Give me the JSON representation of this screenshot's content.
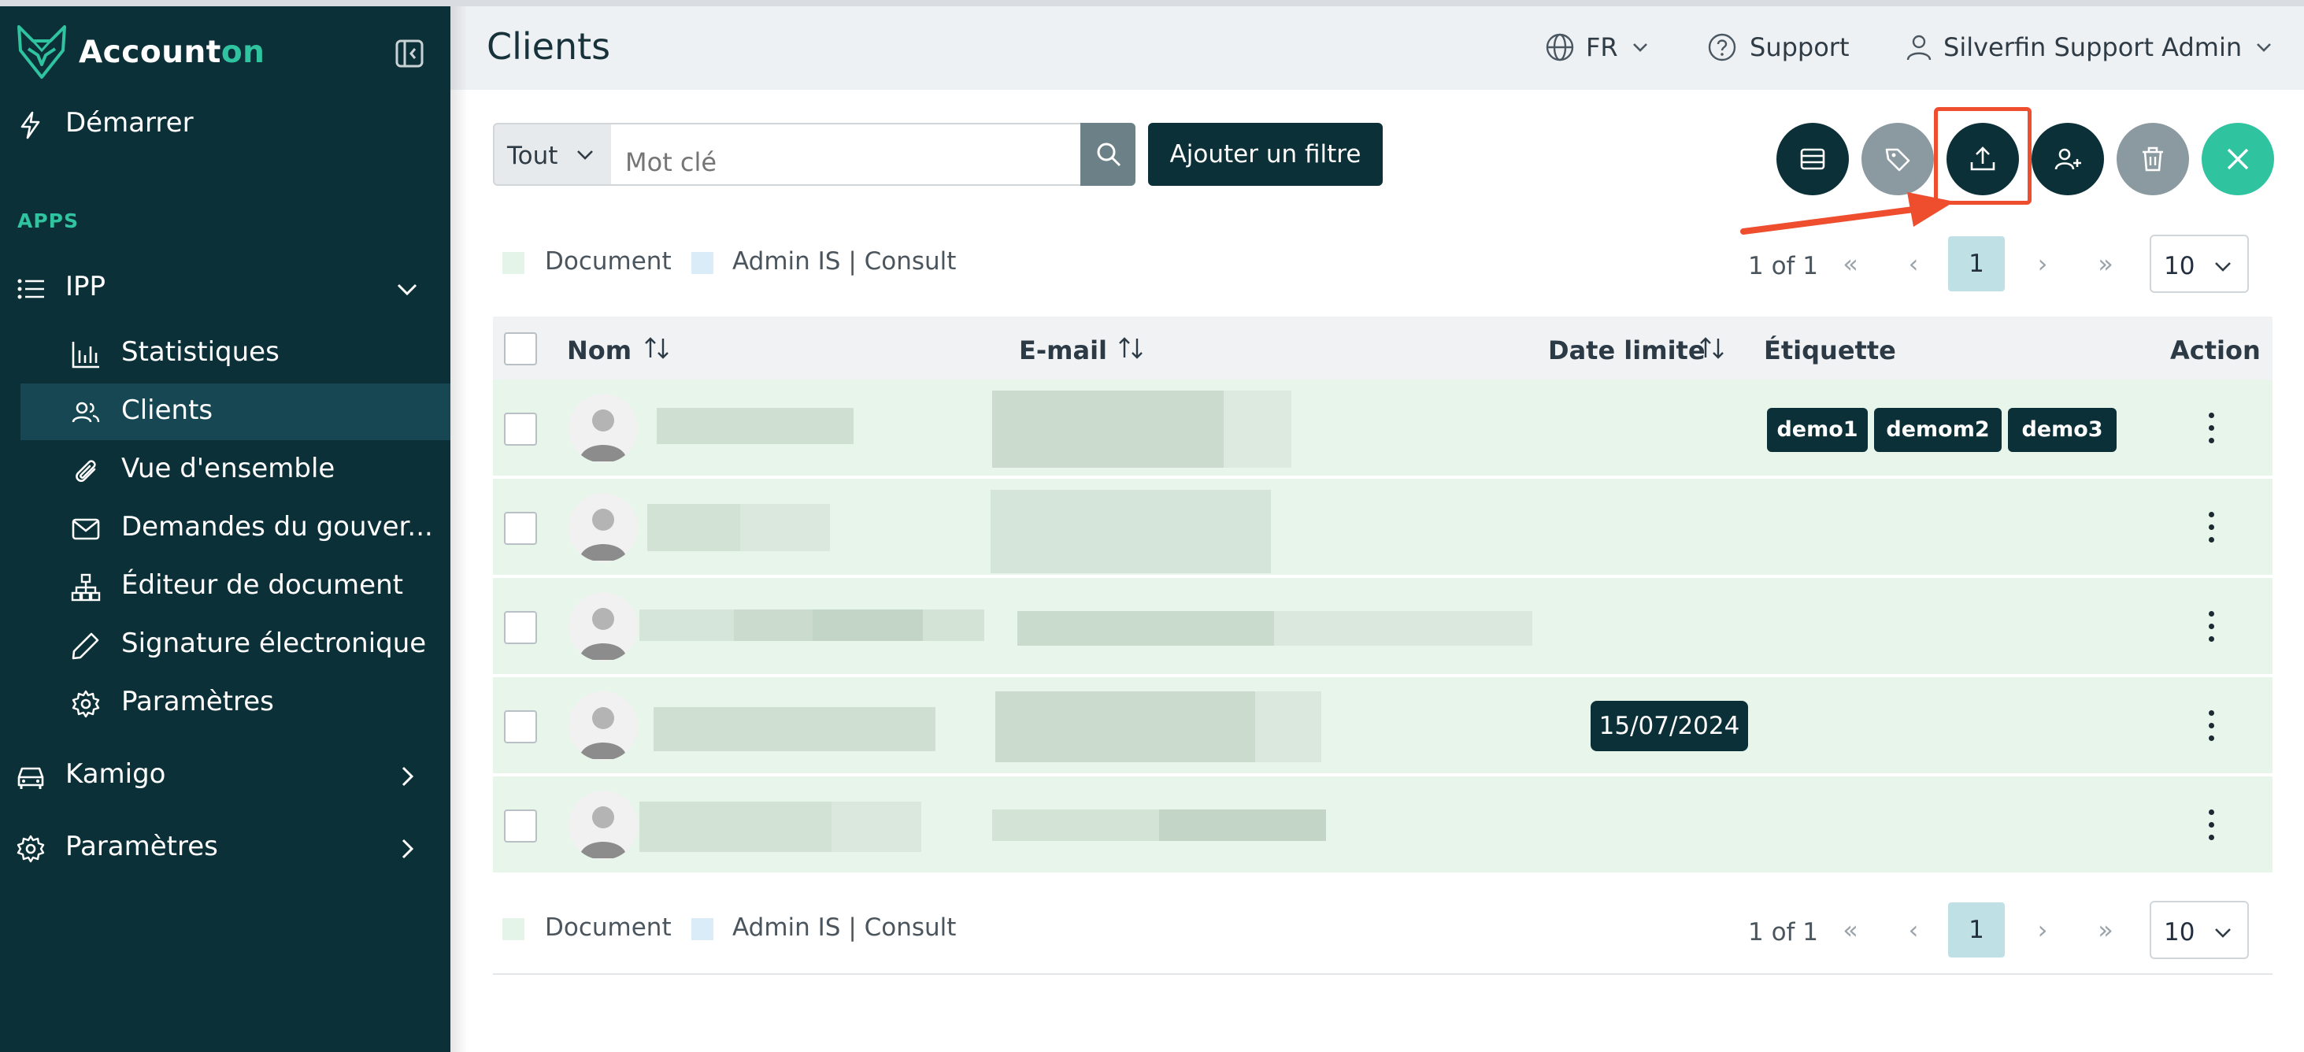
{
  "app": {
    "brand_part1": "Account",
    "brand_part2": "on"
  },
  "sidebar": {
    "start": "Démarrer",
    "apps_label": "APPS",
    "ipp": "IPP",
    "items": [
      {
        "label": "Statistiques",
        "icon": "bar-chart-icon"
      },
      {
        "label": "Clients",
        "icon": "users-icon",
        "active": true
      },
      {
        "label": "Vue d'ensemble",
        "icon": "paperclip-icon"
      },
      {
        "label": "Demandes du gouver...",
        "icon": "mail-icon"
      },
      {
        "label": "Éditeur de document",
        "icon": "sitemap-icon"
      },
      {
        "label": "Signature électronique",
        "icon": "pen-icon"
      },
      {
        "label": "Paramètres",
        "icon": "gear-icon"
      }
    ],
    "kamigo": "Kamigo",
    "settings": "Paramètres"
  },
  "header": {
    "title": "Clients",
    "language": "FR",
    "support": "Support",
    "user": "Silverfin Support Admin"
  },
  "toolbar": {
    "scope": "Tout",
    "search_placeholder": "Mot clé",
    "add_filter": "Ajouter un filtre"
  },
  "legend": {
    "document": "Document",
    "admin": "Admin IS | Consult"
  },
  "pagination": {
    "count": "1 of 1",
    "page": "1",
    "page_size": "10"
  },
  "table": {
    "columns": {
      "name": "Nom",
      "email": "E-mail",
      "deadline": "Date limite",
      "tag": "Étiquette",
      "action": "Action"
    },
    "rows": [
      {
        "tags": [
          "demo1",
          "demom2",
          "demo3"
        ],
        "date": ""
      },
      {
        "tags": [],
        "date": ""
      },
      {
        "tags": [],
        "date": ""
      },
      {
        "tags": [],
        "date": "15/07/2024"
      },
      {
        "tags": [],
        "date": ""
      }
    ]
  },
  "colors": {
    "sidebar_bg": "#0c3038",
    "accent": "#2fc3a0",
    "row_bg": "#e7f5ea",
    "highlight": "#ee4e2e",
    "close_button": "#2fc3a0"
  }
}
